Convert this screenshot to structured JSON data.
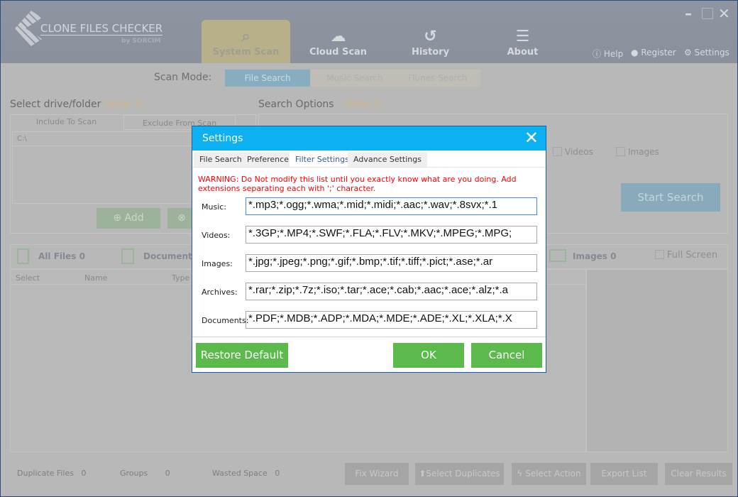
{
  "app": {
    "logo_title": "CLONE FILES CHECKER",
    "logo_sub": "by SORCIM"
  },
  "nav": [
    {
      "label": "System Scan",
      "icon": "system-scan-icon"
    },
    {
      "label": "Cloud Scan",
      "icon": "cloud-scan-icon"
    },
    {
      "label": "History",
      "icon": "history-icon"
    },
    {
      "label": "About",
      "icon": "about-icon"
    }
  ],
  "links": {
    "help": "Help",
    "register": "Register",
    "settings": "Settings"
  },
  "scan_mode": {
    "label": "Scan Mode:",
    "options": [
      "File Search",
      "Music Search",
      "iTunes Search"
    ]
  },
  "step1": {
    "title": "Select drive/folder",
    "step": "(Step 1)",
    "tabs": [
      "Include To Scan",
      "Exclude From Scan"
    ],
    "items": [
      "C:\\"
    ],
    "add": "Add"
  },
  "step2": {
    "title": "Search Options",
    "step": "(Step 2)",
    "checks": [
      "Videos",
      "Images"
    ],
    "start": "Start Search"
  },
  "results": {
    "all_files": "All Files",
    "all_count": "0",
    "documents": "Documents",
    "images": "Images",
    "images_count": "0",
    "full_screen": "Full Screen",
    "columns": [
      "Select",
      "Name",
      "Type"
    ]
  },
  "footer": {
    "dup_label": "Duplicate Files",
    "dup": "0",
    "groups_label": "Groups",
    "groups": "0",
    "wasted_label": "Wasted Space",
    "wasted": "0",
    "buttons": [
      "Fix Wizard",
      "Select Duplicates",
      "Select Action",
      "Export List",
      "Clear Results"
    ]
  },
  "dialog": {
    "title": "Settings",
    "tabs": [
      "File Search",
      "Preference",
      "Filter Settings",
      "Advance Settings"
    ],
    "warning": "WARNING:  Do Not modify this list until you exactly know what are you doing. Add extensions separating each with ';' character.",
    "fields": [
      {
        "label": "Music:",
        "value": "*.mp3;*.ogg;*.wma;*.mid;*.midi;*.aac;*.wav;*.8svx;*.1"
      },
      {
        "label": "Videos:",
        "value": "*.3GP;*.MP4;*.SWF;*.FLA;*.FLV;*.MKV;*.MPEG;*.MPG;"
      },
      {
        "label": "Images:",
        "value": "*.jpg;*.jpeg;*.png;*.gif;*.bmp;*.tif;*.tiff;*.pict;*.ase;*.ar"
      },
      {
        "label": "Archives:",
        "value": "*.rar;*.zip;*.7z;*.iso;*.tar;*.ace;*.cab;*.aac;*.ace;*.alz;*.a"
      },
      {
        "label": "Documents:",
        "value": "*.PDF;*.MDB;*.ADP;*.MDA;*.MDE;*.ADE;*.XL;*.XLA;*.X"
      }
    ],
    "restore": "Restore Default",
    "ok": "OK",
    "cancel": "Cancel"
  }
}
